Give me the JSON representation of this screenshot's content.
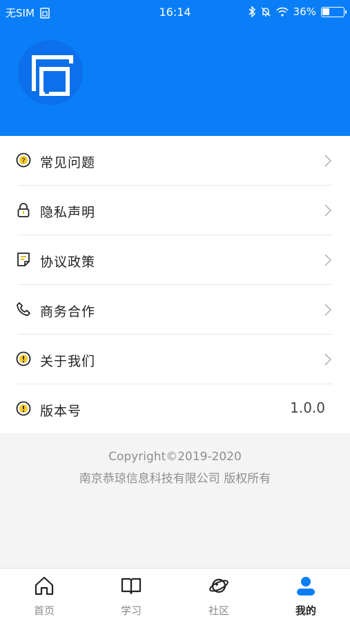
{
  "status_bar": {
    "carrier": "无SIM",
    "time": "16:14",
    "battery": "36%",
    "battery_level": 0.36
  },
  "header": {
    "background_color": "#0a7ef7"
  },
  "menu": {
    "items": [
      {
        "label": "常见问题",
        "icon": "question-circle-icon"
      },
      {
        "label": "隐私声明",
        "icon": "lock-icon"
      },
      {
        "label": "协议政策",
        "icon": "document-icon"
      },
      {
        "label": "商务合作",
        "icon": "phone-icon"
      },
      {
        "label": "关于我们",
        "icon": "info-circle-icon"
      }
    ],
    "version": {
      "label": "版本号",
      "value": "1.0.0",
      "icon": "info-circle-icon"
    }
  },
  "footer": {
    "copyright": "Copyright©2019-2020",
    "company": "南京恭琼信息科技有限公司 版权所有"
  },
  "tabs": [
    {
      "label": "首页",
      "icon": "home-icon",
      "active": false
    },
    {
      "label": "学习",
      "icon": "book-icon",
      "active": false
    },
    {
      "label": "社区",
      "icon": "planet-icon",
      "active": false
    },
    {
      "label": "我的",
      "icon": "user-icon",
      "active": true
    }
  ],
  "colors": {
    "accent": "#0a7ef7",
    "icon_yellow": "#e0b400"
  }
}
